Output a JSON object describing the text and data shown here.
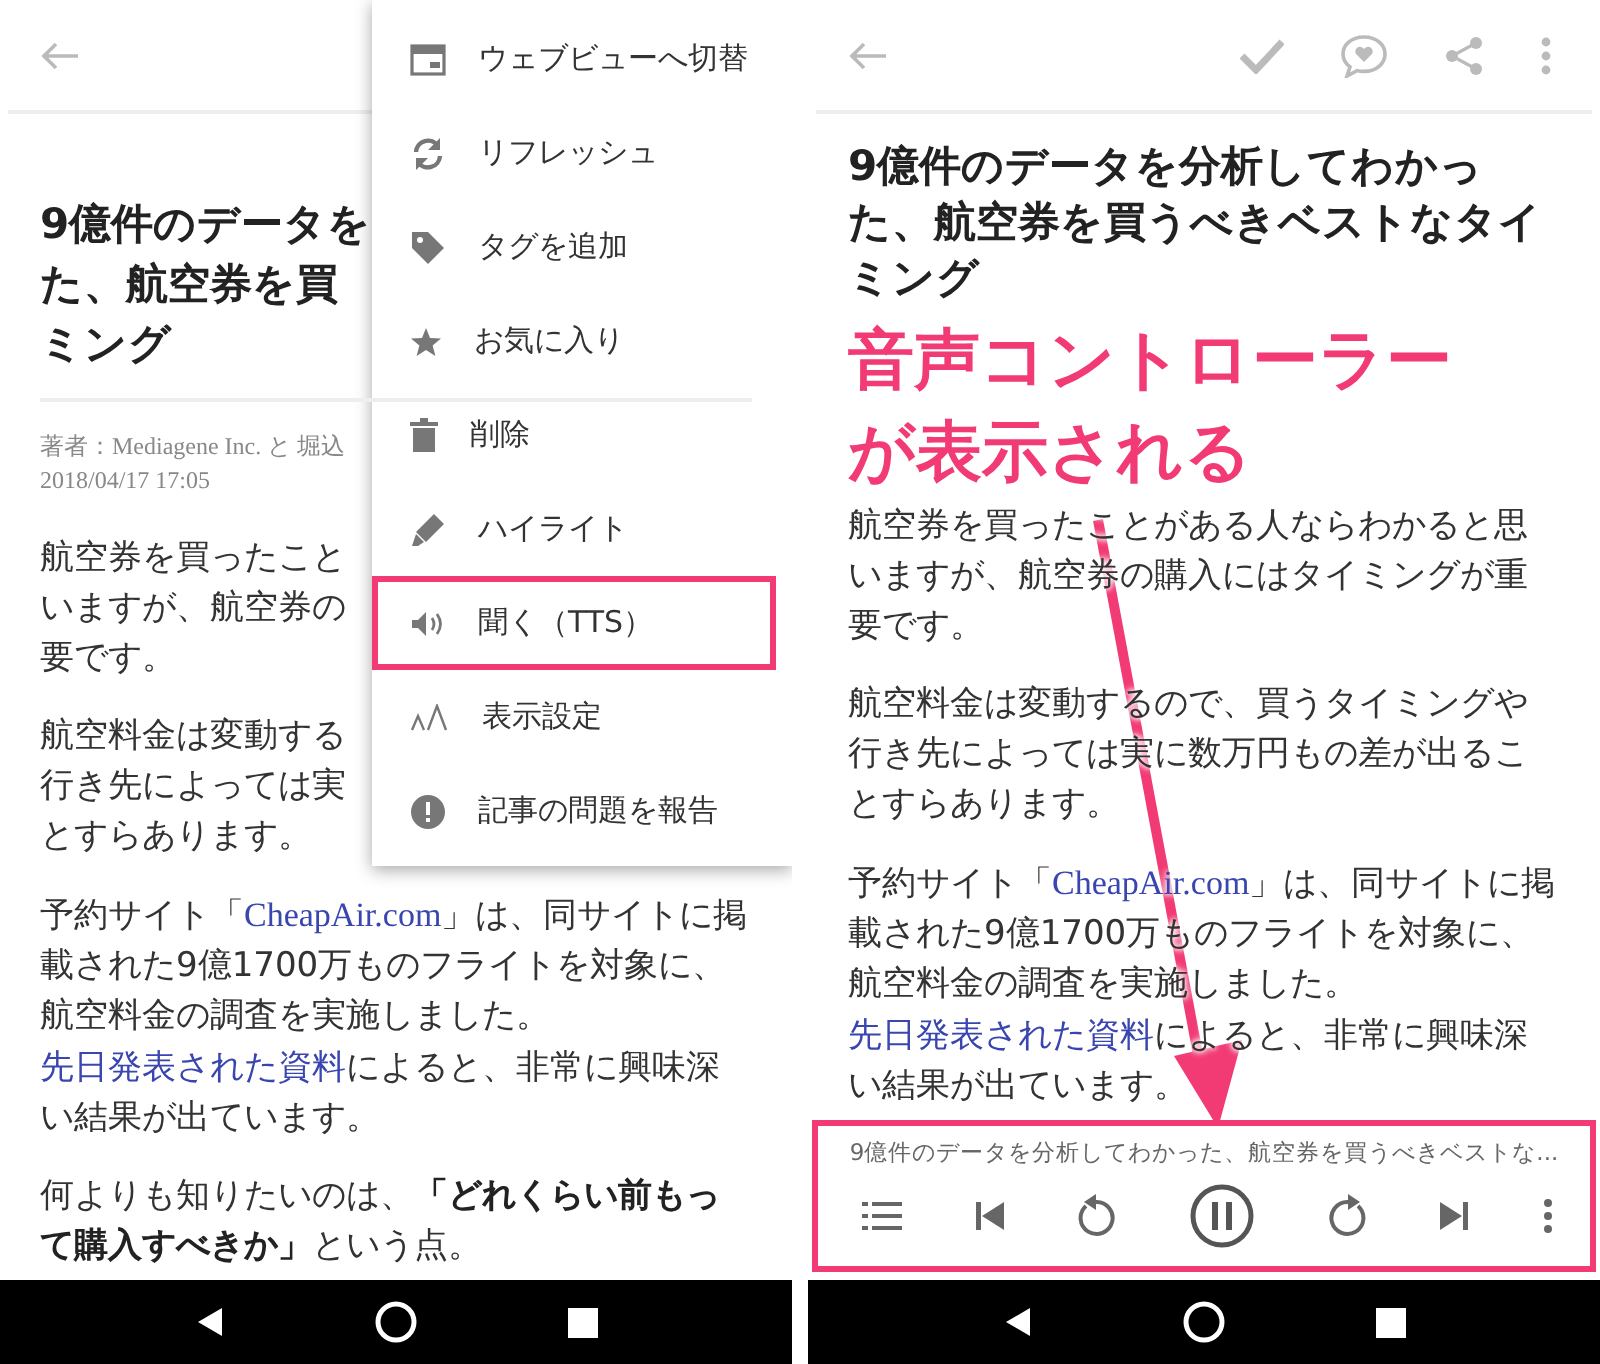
{
  "left_screen": {
    "article": {
      "title_lines": [
        "9億件のデータを",
        "た、航空券を買",
        "ミング"
      ],
      "byline": "著者：Mediagene Inc. と 堀込",
      "date": "2018/04/17 17:05",
      "paragraphs": [
        {
          "kind": "cut",
          "lines": [
            "航空券を買ったこと",
            "いますが、航空券の",
            "要です。"
          ]
        },
        {
          "kind": "cut",
          "lines": [
            "航空料金は変動する",
            "行き先によっては実",
            "とすらあります。"
          ]
        },
        {
          "kind": "full",
          "segments": [
            {
              "kind": "text",
              "text": "予約サイト「"
            },
            {
              "kind": "link",
              "text": "CheapAir.com"
            },
            {
              "kind": "text",
              "text": "」は、同サイトに掲載された9億1700万ものフライトを対象に、航空料金の調査を実施しました。"
            },
            {
              "kind": "link",
              "text": "先日発表された資料"
            },
            {
              "kind": "text",
              "text": "によると、非常に興味深い結果が出ています。"
            }
          ]
        },
        {
          "kind": "full",
          "segments": [
            {
              "kind": "text",
              "text": "何よりも知りたいのは、"
            },
            {
              "kind": "bold",
              "text": "「どれくらい前もって購入すべきか」"
            },
            {
              "kind": "text",
              "text": "という点。"
            }
          ]
        }
      ]
    },
    "menu": {
      "items": [
        {
          "label": "ウェブビューへ切替",
          "highlighted": false
        },
        {
          "label": "リフレッシュ",
          "highlighted": false
        },
        {
          "label": "タグを追加",
          "highlighted": false
        },
        {
          "label": "お気に入り",
          "highlighted": false
        },
        {
          "label": "削除",
          "highlighted": false
        },
        {
          "label": "ハイライト",
          "highlighted": false
        },
        {
          "label": "聞く（TTS）",
          "highlighted": true
        },
        {
          "label": "表示設定",
          "highlighted": false
        },
        {
          "label": "記事の問題を報告",
          "highlighted": false
        }
      ]
    }
  },
  "right_screen": {
    "article": {
      "title": "9億件のデータを分析してわかった、航空券を買うべきベストなタイミング",
      "paragraphs": [
        {
          "kind": "full",
          "segments": [
            {
              "kind": "text",
              "text": "航空券を買ったことがある人ならわかると思いますが、航空券の購入にはタイミングが重要です。"
            }
          ]
        },
        {
          "kind": "full",
          "segments": [
            {
              "kind": "text",
              "text": "航空料金は変動するので、買うタイミングや行き先によっては実に数万円もの差が出ることすらあります。"
            }
          ]
        },
        {
          "kind": "full",
          "segments": [
            {
              "kind": "text",
              "text": "予約サイト「"
            },
            {
              "kind": "link",
              "text": "CheapAir.com"
            },
            {
              "kind": "text",
              "text": "」は、同サイトに掲載された9億1700万ものフライトを対象に、航空料金の調査を実施しました。"
            },
            {
              "kind": "link",
              "text": "先日発表された資料"
            },
            {
              "kind": "text",
              "text": "によると、非常に興味深い結果が出ています。"
            }
          ]
        }
      ]
    },
    "annotation": {
      "lines": [
        "音声コントローラー",
        "が表示される"
      ]
    },
    "audio_controller": {
      "now_playing": "9億件のデータを分析してわかった、航空券を買うべきベストな..."
    }
  }
}
